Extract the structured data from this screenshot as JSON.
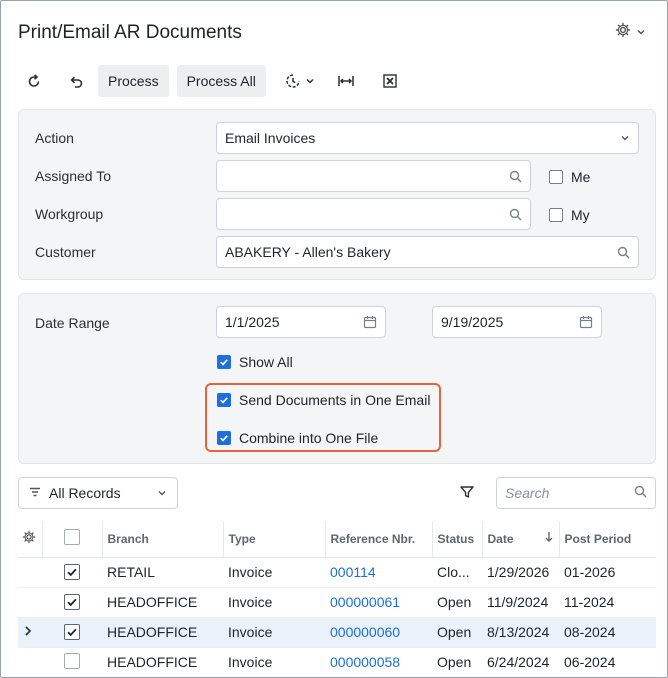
{
  "screen": {
    "title": "Print/Email AR Documents"
  },
  "header": {
    "settings_icon": "gear-icon",
    "settings_chevron": "chevron-down-icon"
  },
  "toolbar": {
    "refresh_icon": "refresh-icon",
    "undo_icon": "undo-icon",
    "process_label": "Process",
    "process_all_label": "Process All",
    "schedule_icon": "clock-icon",
    "fit_width_icon": "fit-columns-icon",
    "export_icon": "excel-icon"
  },
  "selection": {
    "action_label": "Action",
    "action_value": "Email Invoices",
    "assigned_to_label": "Assigned To",
    "assigned_to_value": "",
    "me_label": "Me",
    "me_checked": false,
    "workgroup_label": "Workgroup",
    "workgroup_value": "",
    "my_label": "My",
    "my_checked": false,
    "customer_label": "Customer",
    "customer_value": "ABAKERY - Allen's Bakery"
  },
  "dates": {
    "date_range_label": "Date Range",
    "from": "1/1/2025",
    "to": "9/19/2025",
    "show_all_label": "Show All",
    "show_all_checked": true,
    "one_email_label": "Send Documents in One Email",
    "one_email_checked": true,
    "one_file_label": "Combine into One File",
    "one_file_checked": true
  },
  "grid_toolbar": {
    "filter_label": "All Records",
    "search_placeholder": "Search"
  },
  "table": {
    "columns": [
      "Branch",
      "Type",
      "Reference Nbr.",
      "Status",
      "Date",
      "Post Period"
    ],
    "sort_column": "Date",
    "rows": [
      {
        "selected": true,
        "branch": "RETAIL",
        "type": "Invoice",
        "ref": "000114",
        "status": "Clo...",
        "date": "1/29/2026",
        "period": "01-2026",
        "current": false
      },
      {
        "selected": true,
        "branch": "HEADOFFICE",
        "type": "Invoice",
        "ref": "000000061",
        "status": "Open",
        "date": "11/9/2024",
        "period": "11-2024",
        "current": false
      },
      {
        "selected": true,
        "branch": "HEADOFFICE",
        "type": "Invoice",
        "ref": "000000060",
        "status": "Open",
        "date": "8/13/2024",
        "period": "08-2024",
        "current": true
      },
      {
        "selected": false,
        "branch": "HEADOFFICE",
        "type": "Invoice",
        "ref": "000000058",
        "status": "Open",
        "date": "6/24/2024",
        "period": "06-2024",
        "current": false
      }
    ]
  },
  "colors": {
    "accent": "#1e6fd9",
    "highlight_border": "#e8623a",
    "selected_row": "#e9f2fb"
  }
}
